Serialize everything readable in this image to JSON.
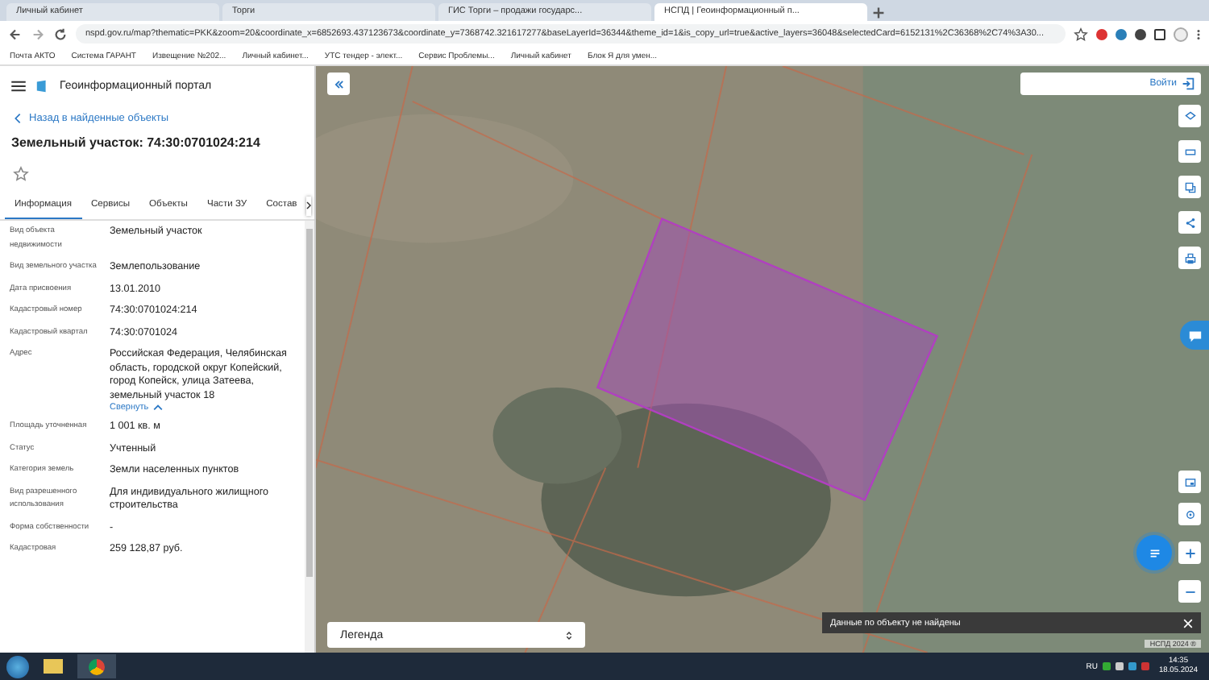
{
  "browser": {
    "tabs": [
      {
        "title": "Личный кабинет",
        "selected": false
      },
      {
        "title": "Торги",
        "selected": false
      },
      {
        "title": "ГИС Торги – продажи государс...",
        "selected": false
      },
      {
        "title": "НСПД | Геоинформационный п...",
        "selected": true
      }
    ],
    "url": "nspd.gov.ru/map?thematic=PKK&zoom=20&coordinate_x=6852693.437123673&coordinate_y=7368742.321617277&baseLayerId=36344&theme_id=1&is_copy_url=true&active_layers=36048&selectedCard=6152131%2C36368%2C74%3A30...",
    "bookmarks": [
      "Почта АКТО",
      "Система ГАРАНТ",
      "Извещение №202...",
      "Личный кабинет...",
      "УТС тендер - элект...",
      "Сервис Проблемы...",
      "Личный кабинет",
      "Блок Я для умен..."
    ]
  },
  "sidebar": {
    "portal_title": "Геоинформационный портал",
    "back_link": "Назад в найденные объекты",
    "heading": "Земельный участок: 74:30:0701024:214",
    "tabs": [
      {
        "label": "Информация",
        "selected": true
      },
      {
        "label": "Сервисы",
        "selected": false
      },
      {
        "label": "Объекты",
        "selected": false
      },
      {
        "label": "Части ЗУ",
        "selected": false
      },
      {
        "label": "Состав",
        "selected": false
      }
    ],
    "fields": [
      {
        "label": "Вид объекта недвижимости",
        "value": "Земельный участок"
      },
      {
        "label": "Вид земельного участка",
        "value": "Землепользование"
      },
      {
        "label": "Дата присвоения",
        "value": "13.01.2010"
      },
      {
        "label": "Кадастровый номер",
        "value": "74:30:0701024:214"
      },
      {
        "label": "Кадастровый квартал",
        "value": "74:30:0701024"
      },
      {
        "label": "Адрес",
        "value": "Российская Федерация, Челябинская область, городской округ Копейский, город Копейск, улица Затеева, земельный участок 18",
        "link": "Свернуть"
      },
      {
        "label": "Площадь уточненная",
        "value": "1 001 кв. м"
      },
      {
        "label": "Статус",
        "value": "Учтенный"
      },
      {
        "label": "Категория земель",
        "value": "Земли населенных пунктов"
      },
      {
        "label": "Вид разрешенного использования",
        "value": "Для индивидуального жилищного строительства"
      },
      {
        "label": "Форма собственности",
        "value": "-"
      },
      {
        "label": "Кадастровая",
        "value": "259 128,87 руб."
      }
    ]
  },
  "map": {
    "login_label": "Войти",
    "legend_label": "Легенда",
    "toast": "Данные по объекту не найдены",
    "attribution": "НСПД 2024 ®"
  },
  "taskbar": {
    "lang": "RU",
    "time": "14:35",
    "date": "18.05.2024"
  }
}
